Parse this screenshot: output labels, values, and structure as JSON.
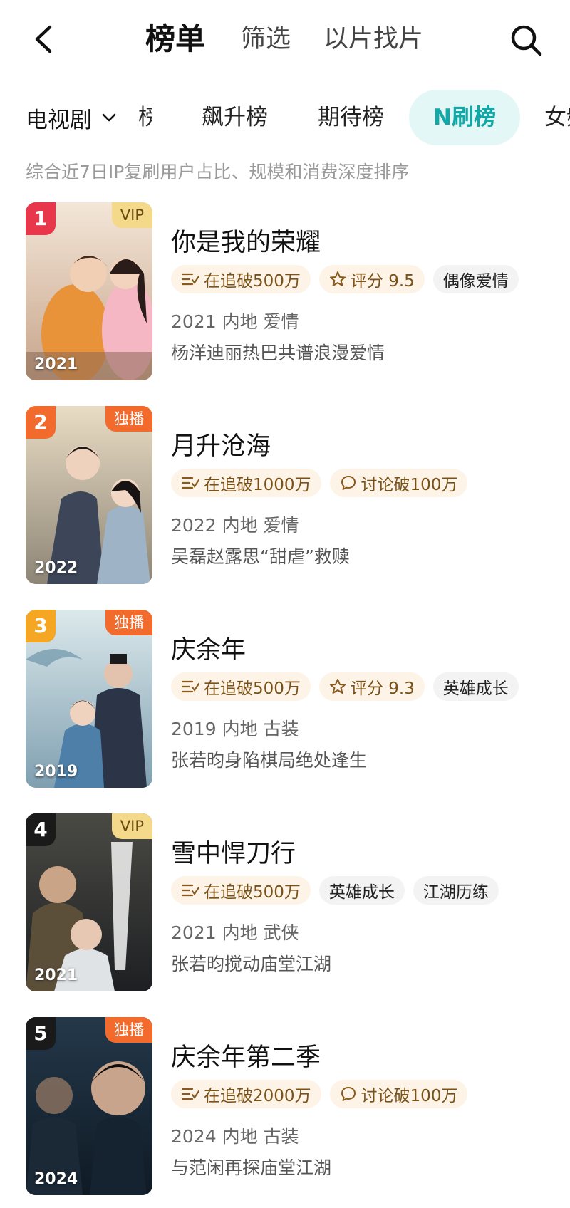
{
  "header": {
    "tabs": [
      {
        "label": "榜单",
        "active": true
      },
      {
        "label": "筛选",
        "active": false
      },
      {
        "label": "以片找片",
        "active": false
      }
    ]
  },
  "categories": {
    "selector": "电视剧",
    "partial_left": "榜",
    "tabs": [
      "飙升榜",
      "期待榜",
      "N刷榜"
    ],
    "partial_right": "女频",
    "active": "N刷榜"
  },
  "description": "综合近7日IP复刷用户占比、规模和消费深度排序",
  "colors": {
    "accent": "#12a8a8",
    "rank1": "#e8364a",
    "rank2": "#f26b2c",
    "rank3": "#f5a623",
    "rank_other": "#1a1a1a"
  },
  "items": [
    {
      "rank": "1",
      "badge": "VIP",
      "year": "2021",
      "title": "你是我的荣耀",
      "tags": [
        {
          "icon": "list-icon",
          "text": "在追破500万"
        },
        {
          "icon": "star-icon",
          "text": "评分 9.5"
        },
        {
          "icon": "",
          "text": "偶像爱情"
        }
      ],
      "meta": "2021 内地 爱情",
      "blurb": "杨洋迪丽热巴共谱浪漫爱情"
    },
    {
      "rank": "2",
      "badge": "独播",
      "year": "2022",
      "title": "月升沧海",
      "tags": [
        {
          "icon": "list-icon",
          "text": "在追破1000万"
        },
        {
          "icon": "chat-icon",
          "text": "讨论破100万"
        }
      ],
      "meta": "2022 内地 爱情",
      "blurb": "吴磊赵露思“甜虐”救赎"
    },
    {
      "rank": "3",
      "badge": "独播",
      "year": "2019",
      "title": "庆余年",
      "tags": [
        {
          "icon": "list-icon",
          "text": "在追破500万"
        },
        {
          "icon": "star-icon",
          "text": "评分 9.3"
        },
        {
          "icon": "",
          "text": "英雄成长"
        }
      ],
      "meta": "2019 内地 古装",
      "blurb": "张若昀身陷棋局绝处逢生"
    },
    {
      "rank": "4",
      "badge": "VIP",
      "year": "2021",
      "title": "雪中悍刀行",
      "tags": [
        {
          "icon": "list-icon",
          "text": "在追破500万"
        },
        {
          "icon": "",
          "text": "英雄成长"
        },
        {
          "icon": "",
          "text": "江湖历练"
        }
      ],
      "meta": "2021 内地 武侠",
      "blurb": "张若昀搅动庙堂江湖"
    },
    {
      "rank": "5",
      "badge": "独播",
      "year": "2024",
      "title": "庆余年第二季",
      "tags": [
        {
          "icon": "list-icon",
          "text": "在追破2000万"
        },
        {
          "icon": "chat-icon",
          "text": "讨论破100万"
        }
      ],
      "meta": "2024 内地 古装",
      "blurb": "与范闲再探庙堂江湖"
    }
  ]
}
